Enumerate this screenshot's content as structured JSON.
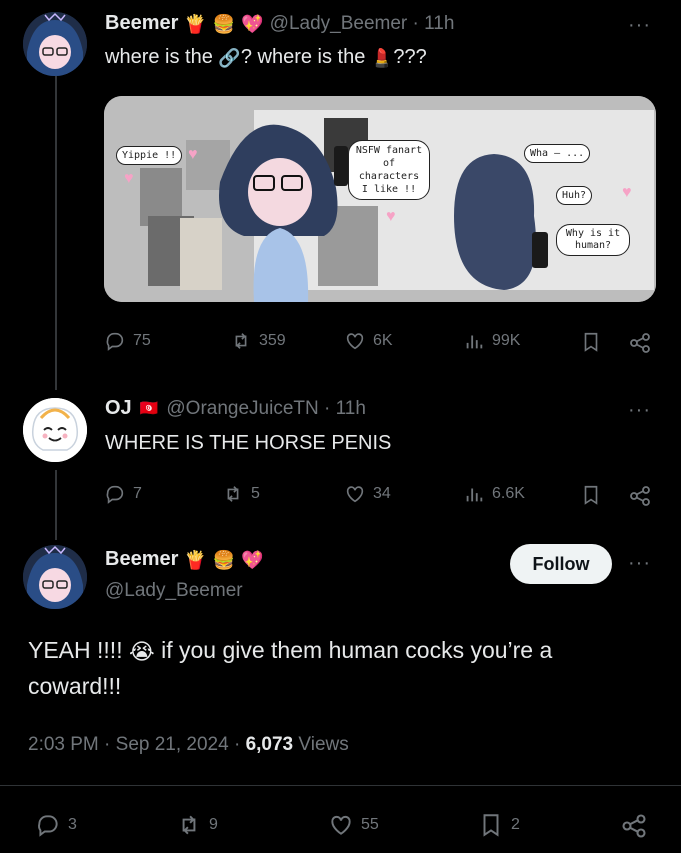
{
  "tweet1": {
    "display_name": "Beemer",
    "name_emojis": [
      "🍟",
      "🍔",
      "💖"
    ],
    "handle_time": "@Lady_Beemer · 11h",
    "text_a": "where is the",
    "text_b": "? where is the",
    "text_c": "???",
    "inline_emojis": [
      "🔗",
      "💄"
    ],
    "comic": {
      "left_bubble": "Yippie !!",
      "center_bubble": "NSFW fanart of characters I like !!",
      "right_bubble_1": "Wha — ...",
      "right_bubble_2": "Huh?",
      "right_bubble_3": "Why is it human?"
    },
    "stats": {
      "replies": "75",
      "reposts": "359",
      "likes": "6K",
      "views": "99K"
    }
  },
  "tweet2": {
    "display_name": "OJ",
    "badge": "🇹🇳",
    "handle_time": "@OrangeJuiceTN · 11h",
    "text": "WHERE IS THE HORSE PENIS",
    "stats": {
      "replies": "7",
      "reposts": "5",
      "likes": "34",
      "views": "6.6K"
    }
  },
  "tweet3": {
    "display_name": "Beemer",
    "name_emojis": [
      "🍟",
      "🍔",
      "💖"
    ],
    "handle": "@Lady_Beemer",
    "follow_label": "Follow",
    "text_line1_a": "YEAH !!!!",
    "text_emoji": "😭",
    "text_line1_b": "if you give them human cocks you’re a",
    "text_line2": "coward!!!",
    "timestamp": "2:03 PM · Sep 21, 2024 · ",
    "views_count": "6,073",
    "views_label": " Views",
    "stats": {
      "replies": "3",
      "reposts": "9",
      "likes": "55",
      "bookmarks": "2"
    }
  },
  "colors": {
    "background": "#000000",
    "text": "#e7e9ea",
    "muted": "#71767b",
    "follow_bg": "#eff3f4"
  },
  "icons": [
    "more-icon",
    "reply-icon",
    "repost-icon",
    "like-icon",
    "views-icon",
    "bookmark-icon",
    "share-icon"
  ]
}
